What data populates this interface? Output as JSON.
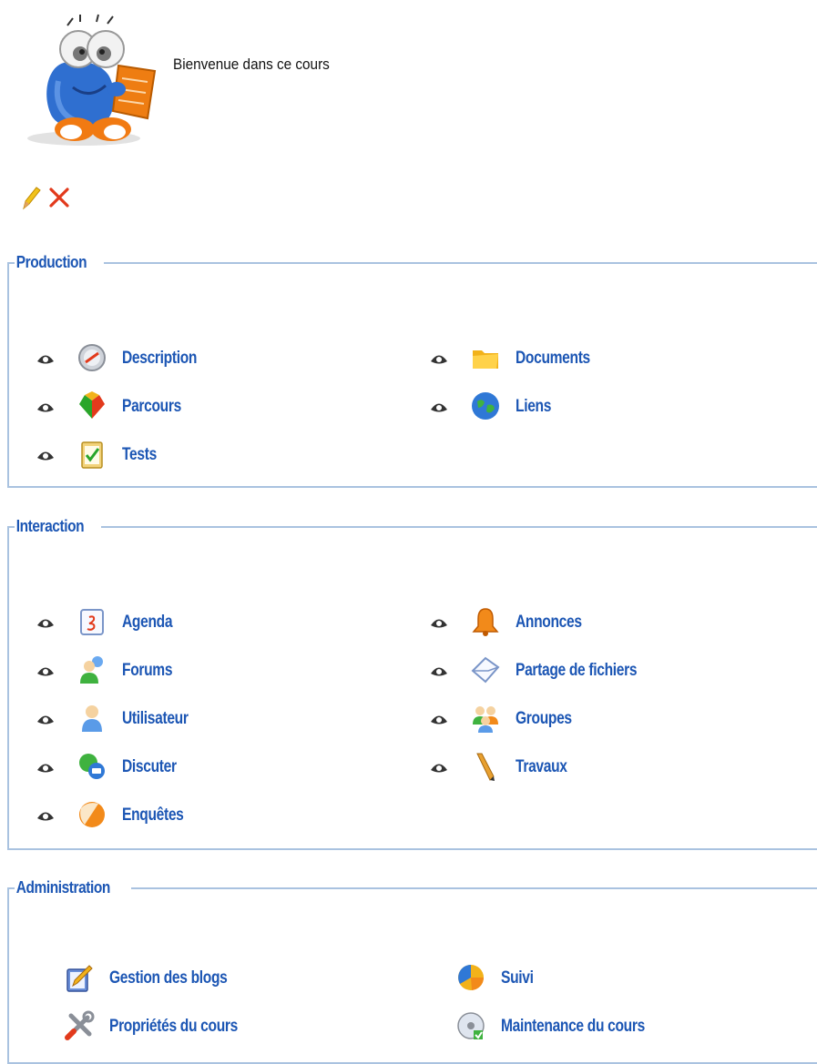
{
  "intro": {
    "welcome_text": "Bienvenue dans ce cours",
    "edit_icon": "pencil-icon",
    "delete_icon": "delete-x-icon"
  },
  "sections": {
    "production": {
      "title": "Production",
      "tools": [
        {
          "label": "Description",
          "icon": "description-icon"
        },
        {
          "label": "Documents",
          "icon": "folder-icon"
        },
        {
          "label": "Parcours",
          "icon": "parcours-icon"
        },
        {
          "label": "Liens",
          "icon": "globe-icon"
        },
        {
          "label": "Tests",
          "icon": "tests-icon"
        }
      ]
    },
    "interaction": {
      "title": "Interaction",
      "tools": [
        {
          "label": "Agenda",
          "icon": "calendar-icon"
        },
        {
          "label": "Annonces",
          "icon": "bell-icon"
        },
        {
          "label": "Forums",
          "icon": "forums-icon"
        },
        {
          "label": "Partage de fichiers",
          "icon": "envelope-icon"
        },
        {
          "label": "Utilisateur",
          "icon": "user-icon"
        },
        {
          "label": "Groupes",
          "icon": "groups-icon"
        },
        {
          "label": "Discuter",
          "icon": "chat-icon"
        },
        {
          "label": "Travaux",
          "icon": "pen-icon"
        },
        {
          "label": "Enquêtes",
          "icon": "survey-icon"
        }
      ]
    },
    "administration": {
      "title": "Administration",
      "tools": [
        {
          "label": "Gestion des blogs",
          "icon": "blog-icon"
        },
        {
          "label": "Suivi",
          "icon": "pie-chart-icon"
        },
        {
          "label": "Propriétés du cours",
          "icon": "tools-icon"
        },
        {
          "label": "Maintenance du cours",
          "icon": "maintenance-icon"
        }
      ]
    }
  },
  "colors": {
    "link": "#1c56b4",
    "border": "#a9c2e0"
  }
}
